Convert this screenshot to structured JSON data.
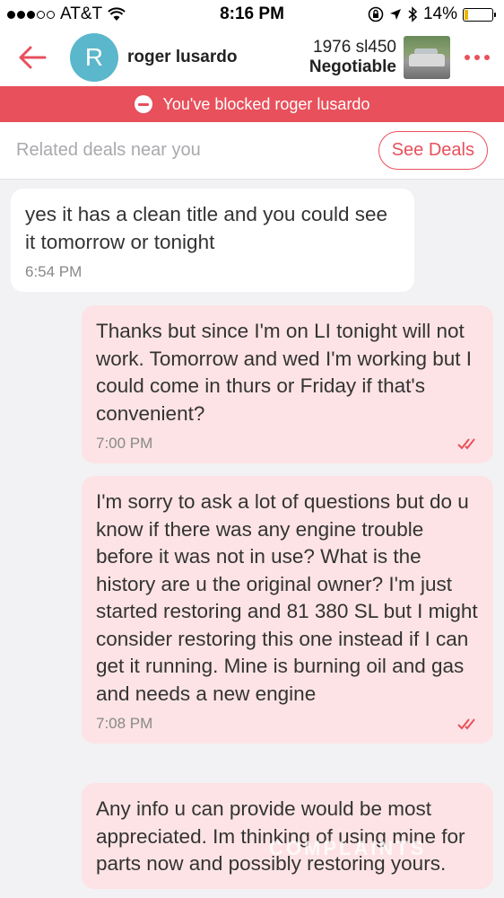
{
  "status_bar": {
    "carrier": "AT&T",
    "time": "8:16 PM",
    "battery": "14%",
    "battery_level": 0.14
  },
  "header": {
    "contact_initial": "R",
    "contact_name": "roger lusardo",
    "listing_title": "1976 sl450",
    "listing_price": "Negotiable"
  },
  "banner": {
    "blocked_text": "You've blocked roger lusardo"
  },
  "deals": {
    "label": "Related deals near you",
    "button": "See Deals"
  },
  "messages": [
    {
      "direction": "in",
      "text": "yes it has a clean title and you could see it tomorrow or tonight",
      "time": "6:54 PM"
    },
    {
      "direction": "out",
      "text": "Thanks but since I'm on LI tonight will not work. Tomorrow and wed I'm working but I could come in thurs or Friday if that's convenient?",
      "time": "7:00 PM"
    },
    {
      "direction": "out",
      "text": "I'm sorry to ask a lot of questions but do u know if there was any engine trouble before it was not in use? What is the history are u the original owner? I'm just started restoring and 81 380 SL but I might consider restoring this one instead if I can get it running. Mine is burning oil and gas and needs a new engine",
      "time": "7:08 PM"
    },
    {
      "direction": "out",
      "text": "Any info u can provide would be most appreciated. Im thinking of using mine for parts now and possibly restoring yours.",
      "time": ""
    }
  ],
  "watermark": "COMPLAINTS",
  "colors": {
    "accent": "#e8505b",
    "outgoing_bubble": "#fde3e5",
    "incoming_bubble": "#ffffff",
    "avatar": "#5bb7cc"
  }
}
